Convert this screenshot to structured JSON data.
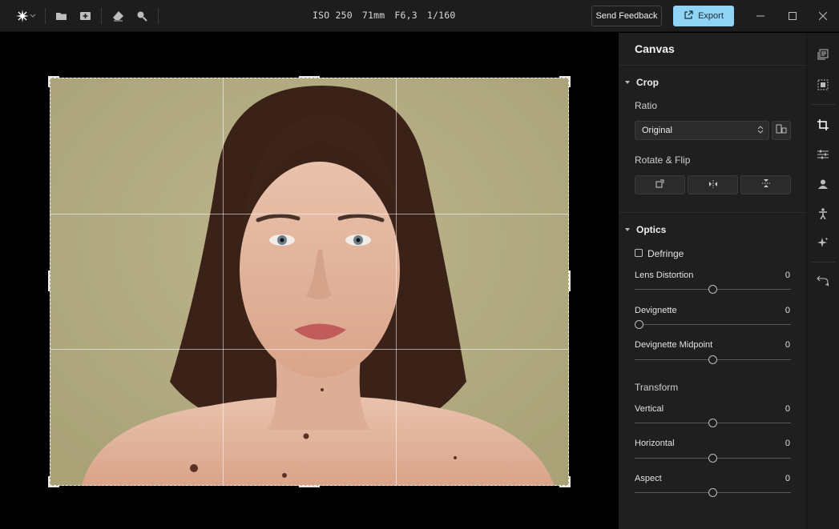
{
  "topbar": {
    "exif": {
      "iso": "ISO 250",
      "focal": "71mm",
      "aperture": "F6,3",
      "shutter": "1/160"
    },
    "feedback_label": "Send Feedback",
    "export_label": "Export",
    "icons": [
      "app-logo-icon",
      "folder-icon",
      "import-icon",
      "eraser-icon",
      "zoom-icon",
      "minimize-icon",
      "maximize-icon",
      "close-icon"
    ]
  },
  "panel": {
    "title": "Canvas",
    "crop": {
      "heading": "Crop",
      "ratio_label": "Ratio",
      "ratio_value": "Original",
      "rotate_flip_label": "Rotate & Flip"
    },
    "optics": {
      "heading": "Optics",
      "defringe_label": "Defringe",
      "defringe_checked": false,
      "sliders": [
        {
          "label": "Lens Distortion",
          "value": "0",
          "position": 0.5
        },
        {
          "label": "Devignette",
          "value": "0",
          "position": 0.0
        },
        {
          "label": "Devignette Midpoint",
          "value": "0",
          "position": 0.5
        }
      ]
    },
    "transform": {
      "heading": "Transform",
      "sliders": [
        {
          "label": "Vertical",
          "value": "0",
          "position": 0.5
        },
        {
          "label": "Horizontal",
          "value": "0",
          "position": 0.5
        },
        {
          "label": "Aspect",
          "value": "0",
          "position": 0.5
        }
      ]
    }
  },
  "rail": {
    "icons": [
      "layers-icon",
      "select-icon",
      "crop-icon",
      "adjust-icon",
      "portrait-icon",
      "body-icon",
      "magic-icon",
      "undo-icon"
    ]
  },
  "colors": {
    "accent": "#8fd3f5",
    "background": "#b4ad82"
  }
}
